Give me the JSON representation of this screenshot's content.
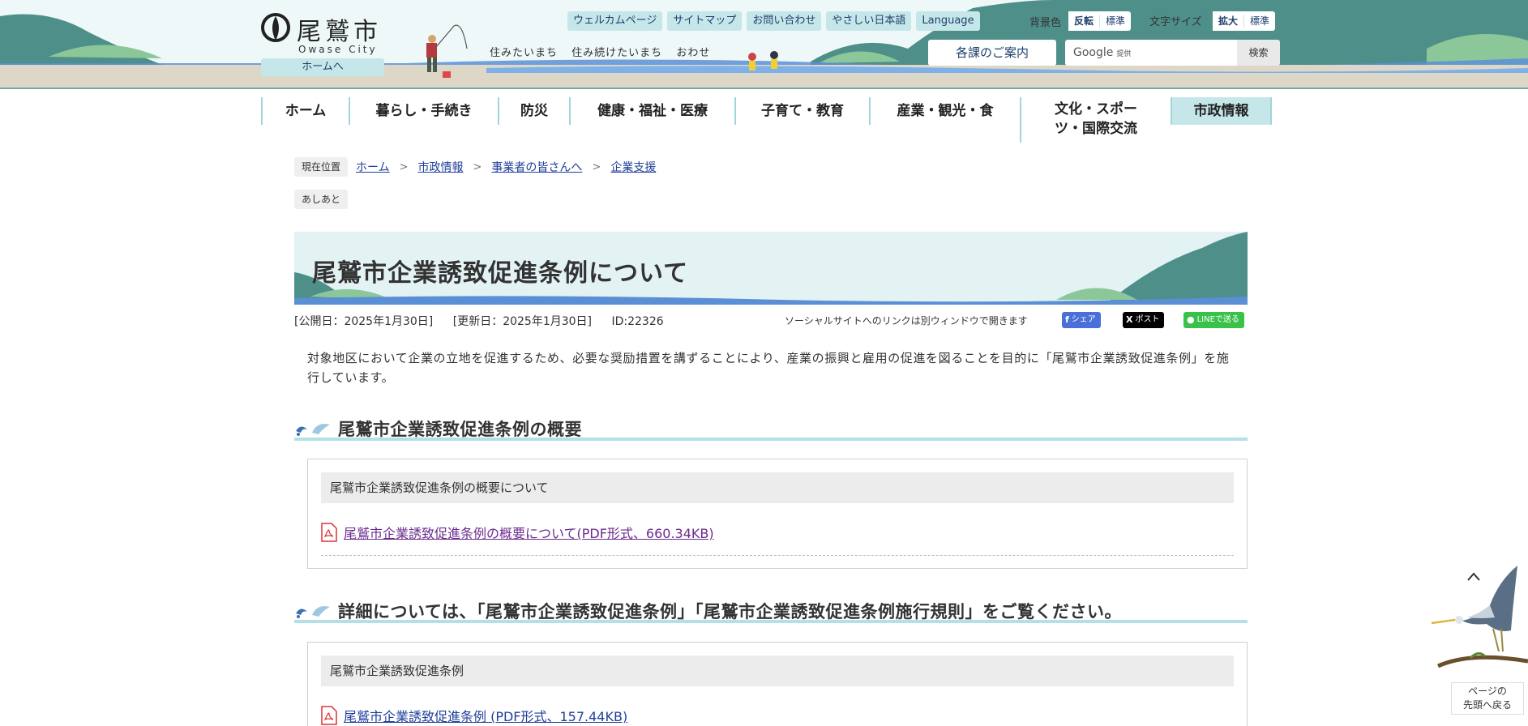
{
  "header": {
    "logo_text": "尾鷲市",
    "logo_sub": "Owase City",
    "home_link": "ホームへ",
    "tagline": [
      "住みたいまち",
      "住み続けたいまち",
      "おわせ"
    ],
    "top_links": [
      "ウェルカムページ",
      "サイトマップ",
      "お問い合わせ",
      "やさしい日本語",
      "Language"
    ],
    "bg_label": "背景色",
    "bg_options": [
      "反転",
      "標準"
    ],
    "size_label": "文字サイズ",
    "size_options": [
      "拡大",
      "標準"
    ],
    "division_button": "各課のご案内",
    "search_brand": "Google",
    "search_brand_sub": "提供",
    "search_button": "検索"
  },
  "nav": [
    {
      "label": "ホーム",
      "active": false
    },
    {
      "label": "暮らし・手続き",
      "active": false
    },
    {
      "label": "防災",
      "active": false
    },
    {
      "label": "健康・福祉・医療",
      "active": false
    },
    {
      "label": "子育て・教育",
      "active": false
    },
    {
      "label": "産業・観光・食",
      "active": false
    },
    {
      "label": "文化・スポーツ・国際交流",
      "active": false
    },
    {
      "label": "市政情報",
      "active": true
    }
  ],
  "breadcrumb": {
    "tag": "現在位置",
    "items": [
      "ホーム",
      "市政情報",
      "事業者の皆さんへ",
      "企業支援"
    ],
    "ashiato": "あしあと"
  },
  "page": {
    "title": "尾鷲市企業誘致促進条例について",
    "published": "[公開日：2025年1月30日]",
    "updated": "[更新日：2025年1月30日]",
    "id": "ID:22326",
    "social_note": "ソーシャルサイトへのリンクは別ウィンドウで開きます",
    "share_fb": "シェア",
    "share_x": "ポスト",
    "share_line": "LINEで送る",
    "intro": "対象地区において企業の立地を促進するため、必要な奨励措置を講ずることにより、産業の振興と雇用の促進を図ることを目的に「尾鷲市企業誘致促進条例」を施行しています。"
  },
  "sections": [
    {
      "heading": "尾鷲市企業誘致促進条例の概要",
      "box_title": "尾鷲市企業誘致促進条例の概要について",
      "file": "尾鷲市企業誘致促進条例の概要について(PDF形式、660.34KB)"
    },
    {
      "heading": "詳細については、「尾鷲市企業誘致促進条例」「尾鷲市企業誘致促進条例施行規則」をご覧ください。",
      "box_title": "尾鷲市企業誘致促進条例",
      "file": "尾鷲市企業誘致促進条例 (PDF形式、157.44KB)"
    }
  ],
  "pagetop": {
    "line1": "ページの",
    "line2": "先頭へ戻る"
  },
  "colors": {
    "accent": "#c6e7ea",
    "nav_border": "#9fd6dc",
    "link": "#1f3f99",
    "visited_link": "#6b2b8f",
    "hill": "#4e8f8a"
  }
}
